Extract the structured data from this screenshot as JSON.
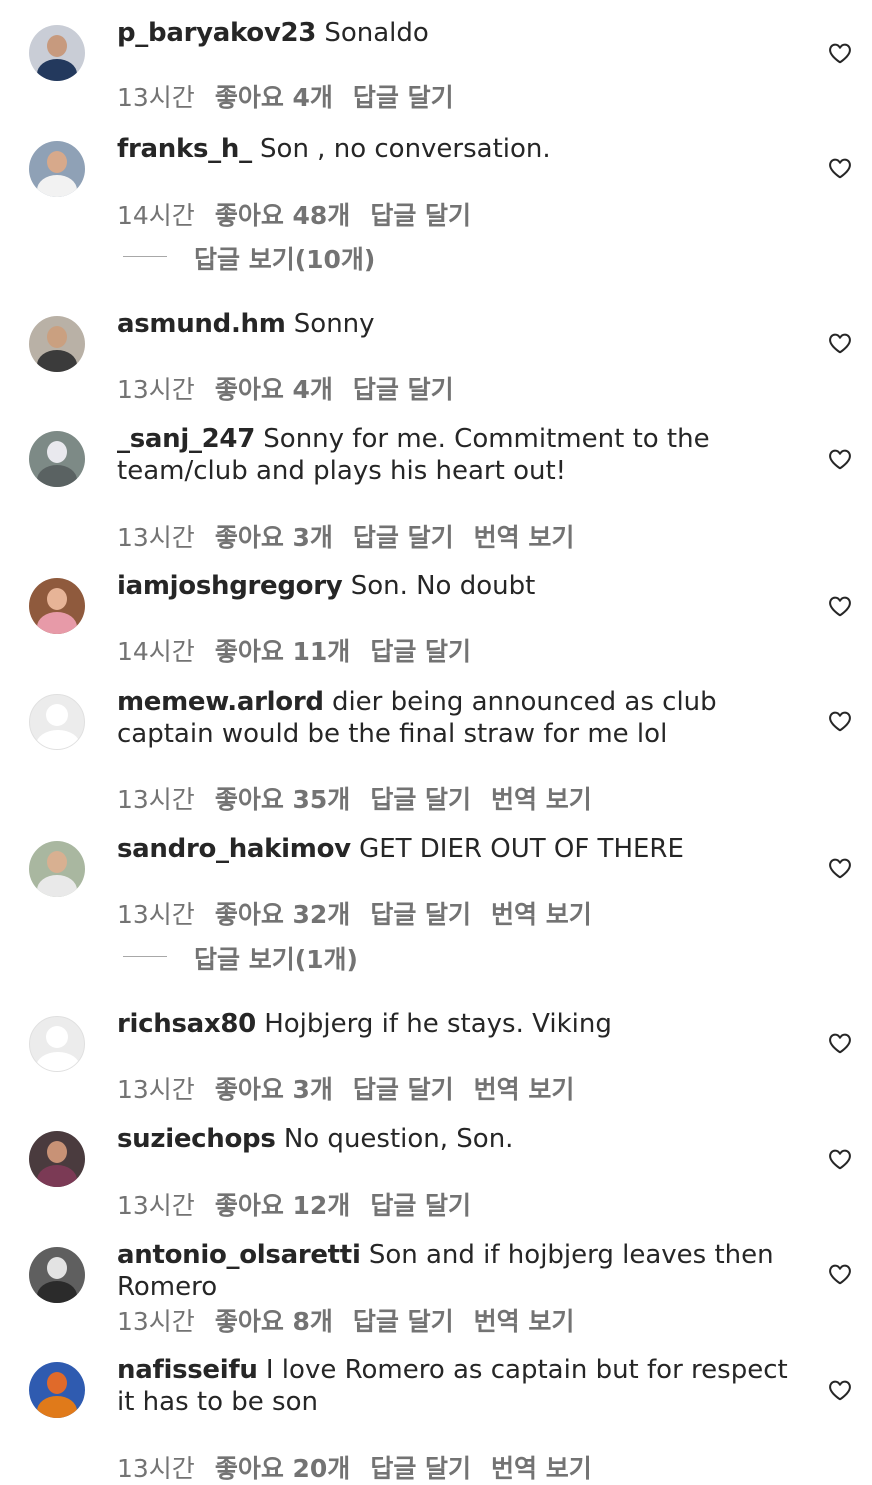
{
  "comments": [
    {
      "username": "p_baryakov23",
      "text": "Sonaldo",
      "time": "13시간",
      "likes": "좋아요 4개",
      "reply": "답글 달기",
      "avatar": {
        "bg": "#c9cdd6",
        "skin": "#c79a7e",
        "shirt": "#23395d"
      }
    },
    {
      "username": "franks_h_",
      "text": "Son , no conversation.",
      "time": "14시간",
      "likes": "좋아요 48개",
      "reply": "답글 달기",
      "avatar": {
        "bg": "#8fa1b6",
        "skin": "#d7a98b",
        "shirt": "#f2f2f2"
      }
    },
    {
      "username": "asmund.hm",
      "text": "Sonny",
      "time": "13시간",
      "likes": "좋아요 4개",
      "reply": "답글 달기",
      "avatar": {
        "bg": "#b9b1a6",
        "skin": "#caa080",
        "shirt": "#3b3b3b"
      }
    },
    {
      "username": "_sanj_247",
      "text": "Sonny for me. Commitment to the team/club and plays his heart out!",
      "time": "13시간",
      "likes": "좋아요 3개",
      "reply": "답글 달기",
      "translate": "번역 보기",
      "avatar": {
        "bg": "#7d8a86",
        "skin": "#e9e9ee",
        "shirt": "#5a6262"
      }
    },
    {
      "username": "iamjoshgregory",
      "text": "Son. No doubt",
      "time": "14시간",
      "likes": "좋아요 11개",
      "reply": "답글 달기",
      "avatar": {
        "bg": "#8f5a3d",
        "skin": "#e7b497",
        "shirt": "#e79aa8"
      }
    },
    {
      "username": "memew.arlord",
      "text": "dier being announced as club captain would be the final straw for me lol",
      "time": "13시간",
      "likes": "좋아요 35개",
      "reply": "답글 달기",
      "translate": "번역 보기",
      "avatar": "default"
    },
    {
      "username": "sandro_hakimov",
      "text": "GET DIER OUT OF THERE",
      "time": "13시간",
      "likes": "좋아요 32개",
      "reply": "답글 달기",
      "translate": "번역 보기",
      "avatar": {
        "bg": "#a9b7a0",
        "skin": "#d8b091",
        "shirt": "#e9e9e9"
      }
    },
    {
      "username": "richsax80",
      "text": "Hojbjerg if he stays. Viking",
      "time": "13시간",
      "likes": "좋아요 3개",
      "reply": "답글 달기",
      "translate": "번역 보기",
      "avatar": "default"
    },
    {
      "username": "suziechops",
      "text": "No question, Son.",
      "time": "13시간",
      "likes": "좋아요 12개",
      "reply": "답글 달기",
      "avatar": {
        "bg": "#4a3b3e",
        "skin": "#c89276",
        "shirt": "#7b3a55"
      }
    },
    {
      "username": "antonio_olsaretti",
      "text": "Son and if hojbjerg leaves then Romero",
      "time": "13시간",
      "likes": "좋아요 8개",
      "reply": "답글 달기",
      "translate": "번역 보기",
      "avatar": {
        "bg": "#5f5f5f",
        "skin": "#e3e3e3",
        "shirt": "#2b2b2b"
      }
    },
    {
      "username": "nafisseifu",
      "text": "I love Romero as captain but for respect it has to be son",
      "time": "13시간",
      "likes": "좋아요 20개",
      "reply": "답글 달기",
      "translate": "번역 보기",
      "avatar": {
        "bg": "#2f5bb0",
        "skin": "#e06a2a",
        "shirt": "#e07a1a"
      }
    }
  ],
  "view_replies": [
    {
      "label": "답글 보기(10개)"
    },
    {
      "label": "답글 보기(1개)"
    }
  ]
}
